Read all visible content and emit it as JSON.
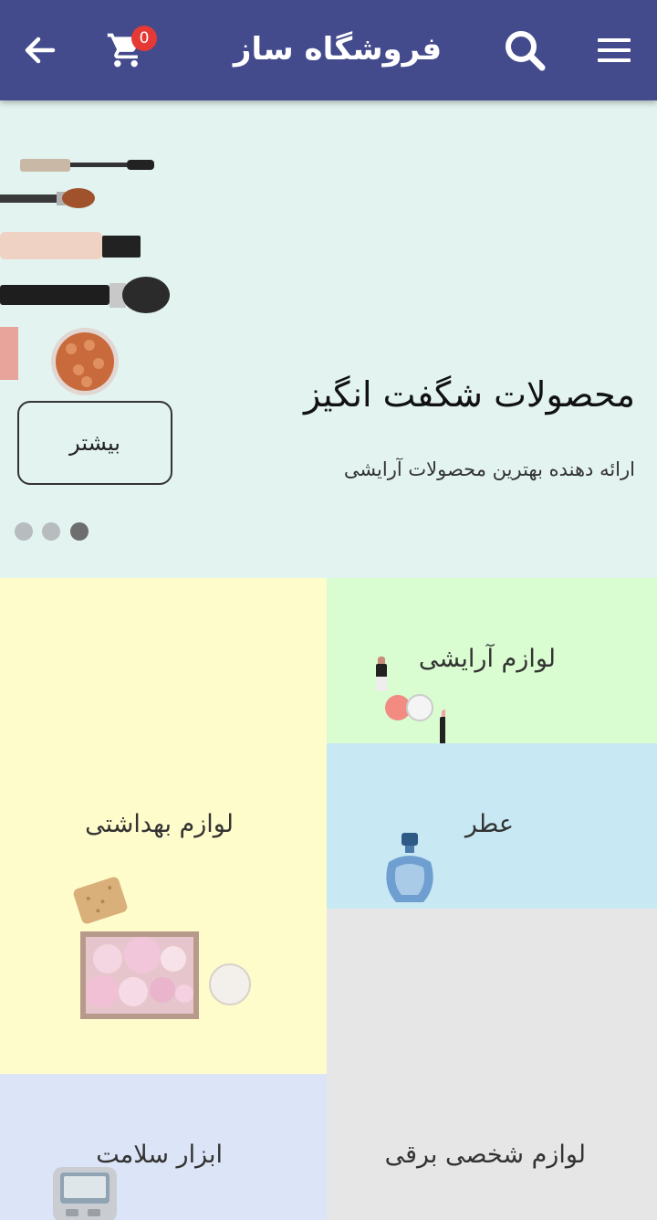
{
  "appbar": {
    "title": "فروشگاه ساز",
    "cart_count": "0",
    "icons": [
      "menu-icon",
      "search-icon",
      "cart-icon",
      "back-arrow-icon"
    ],
    "background": "#434b8c"
  },
  "hero": {
    "title": "محصولات شگفت انگیز",
    "subtitle": "ارائه دهنده بهترین محصولات آرایشی",
    "button_label": "بیشتر",
    "slides": 3,
    "active_slide": 3,
    "background": "#e2f3f0"
  },
  "categories": [
    {
      "label": "لوازم آرایشی",
      "color": "#d9fcd1",
      "icon": "cosmetics-icon"
    },
    {
      "label": "لوازم بهداشتی",
      "color": "#fffccc",
      "icon": "toiletries-icon"
    },
    {
      "label": "عطر",
      "color": "#c8e8f4",
      "icon": "perfume-bottle-icon"
    },
    {
      "label": "ابزار سلامت",
      "color": "#dce4f7",
      "icon": "blood-pressure-monitor-icon"
    },
    {
      "label": "لوازم شخصی برقی",
      "color": "#e6e6e6",
      "icon": ""
    }
  ]
}
